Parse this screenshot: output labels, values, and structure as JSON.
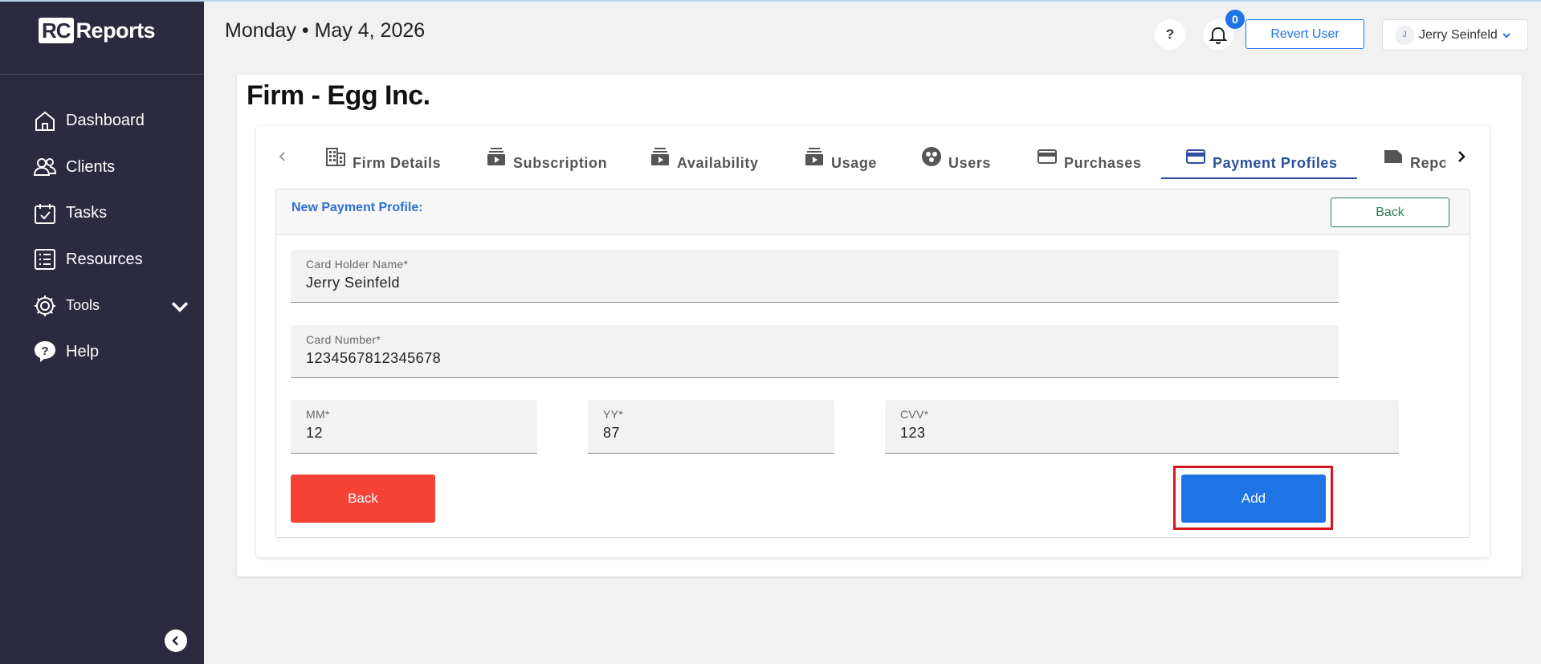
{
  "app": {
    "logo_mark": "RC",
    "logo_text": "Reports"
  },
  "sidebar": {
    "items": [
      {
        "label": "Dashboard",
        "icon": "home-icon"
      },
      {
        "label": "Clients",
        "icon": "users-icon"
      },
      {
        "label": "Tasks",
        "icon": "calendar-check-icon"
      },
      {
        "label": "Resources",
        "icon": "list-icon"
      },
      {
        "label": "Tools",
        "icon": "gear-icon"
      },
      {
        "label": "Help",
        "icon": "help-bubble-icon"
      }
    ]
  },
  "header": {
    "date": "Monday • May 4, 2026",
    "help_label": "?",
    "notification_count": "0",
    "revert_label": "Revert User",
    "user_initial": "J",
    "user_name": "Jerry Seinfeld"
  },
  "page": {
    "title": "Firm - Egg Inc.",
    "tabs": [
      {
        "label": "Firm Details",
        "icon": "building-icon"
      },
      {
        "label": "Subscription",
        "icon": "media-stack-icon"
      },
      {
        "label": "Availability",
        "icon": "media-stack-icon"
      },
      {
        "label": "Usage",
        "icon": "media-stack-icon"
      },
      {
        "label": "Users",
        "icon": "users-circle-icon"
      },
      {
        "label": "Purchases",
        "icon": "credit-card-icon"
      },
      {
        "label": "Payment Profiles",
        "icon": "credit-card-icon"
      },
      {
        "label": "Repor",
        "icon": "label-icon"
      }
    ],
    "active_tab": "Payment Profiles"
  },
  "form": {
    "title": "New Payment Profile:",
    "back_top_label": "Back",
    "card_holder": {
      "label": "Card Holder Name*",
      "value": "Jerry Seinfeld"
    },
    "card_number": {
      "label": "Card Number*",
      "value": "1234567812345678"
    },
    "mm": {
      "label": "MM*",
      "value": "12"
    },
    "yy": {
      "label": "YY*",
      "value": "87"
    },
    "cvv": {
      "label": "CVV*",
      "value": "123"
    },
    "back_label": "Back",
    "add_label": "Add"
  },
  "colors": {
    "sidebar_bg": "#2b2a40",
    "accent_blue": "#1f74e5",
    "tab_active": "#2c4f9e",
    "danger_red": "#f44336",
    "success_green": "#2e7d56",
    "highlight_red": "#d9161f"
  }
}
